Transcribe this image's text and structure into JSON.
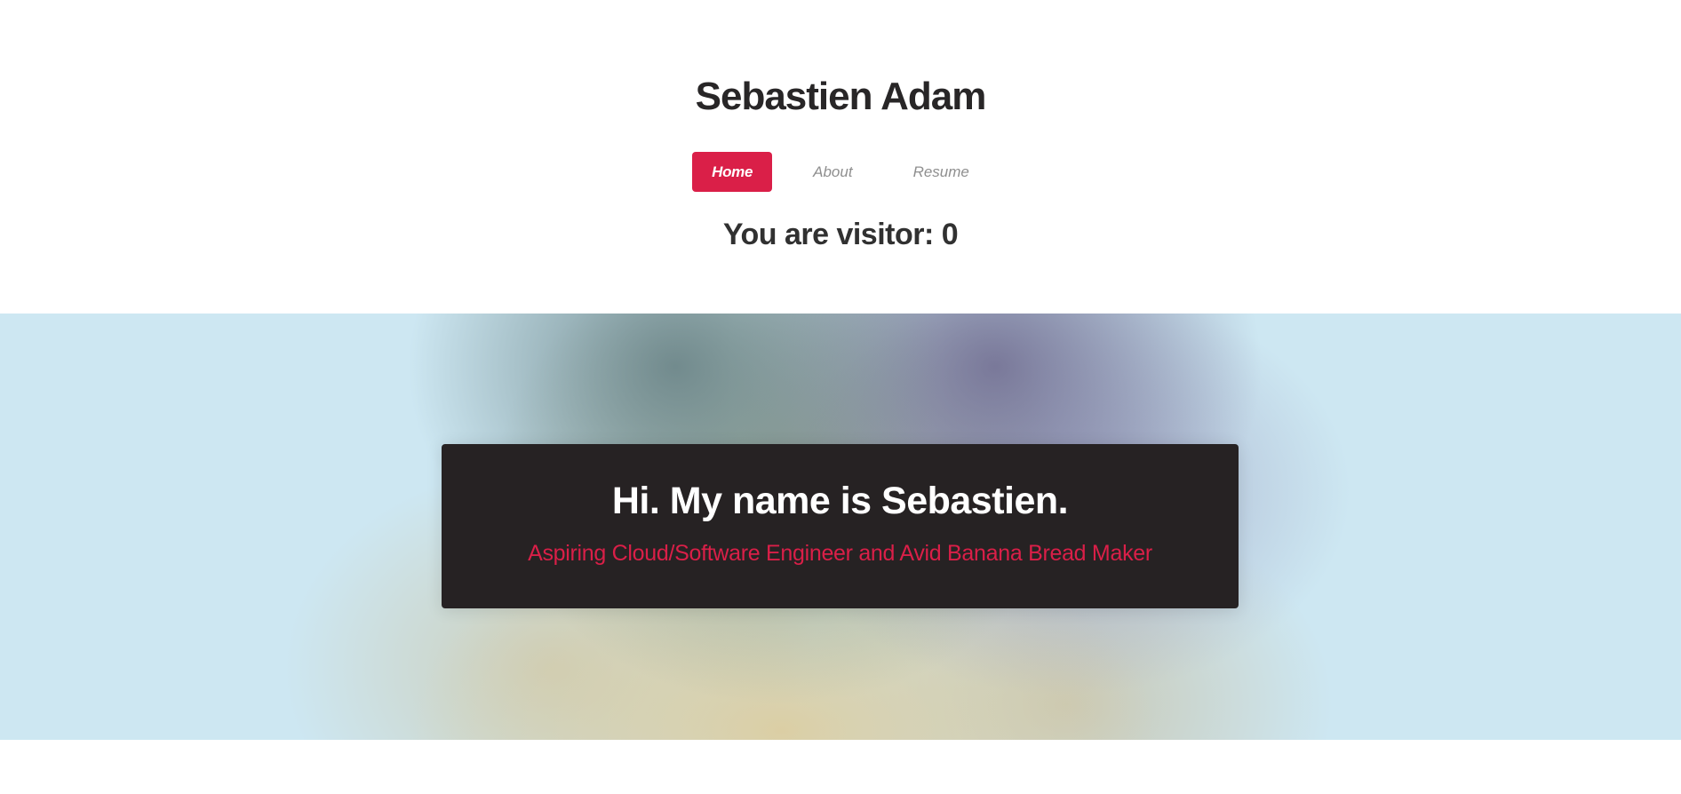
{
  "site": {
    "title": "Sebastien Adam"
  },
  "nav": {
    "items": [
      {
        "label": "Home",
        "active": true
      },
      {
        "label": "About",
        "active": false
      },
      {
        "label": "Resume",
        "active": false
      }
    ]
  },
  "visitor": {
    "text": "You are visitor: 0"
  },
  "hero": {
    "heading": "Hi. My name is Sebastien.",
    "subtitle": "Aspiring Cloud/Software Engineer and Avid Banana Bread Maker"
  },
  "colors": {
    "accent": "#da1f48",
    "hero_box": "#262223",
    "title_text": "#282627",
    "nav_inactive": "#8f8f8f",
    "hero_background": "#cde7f2"
  }
}
